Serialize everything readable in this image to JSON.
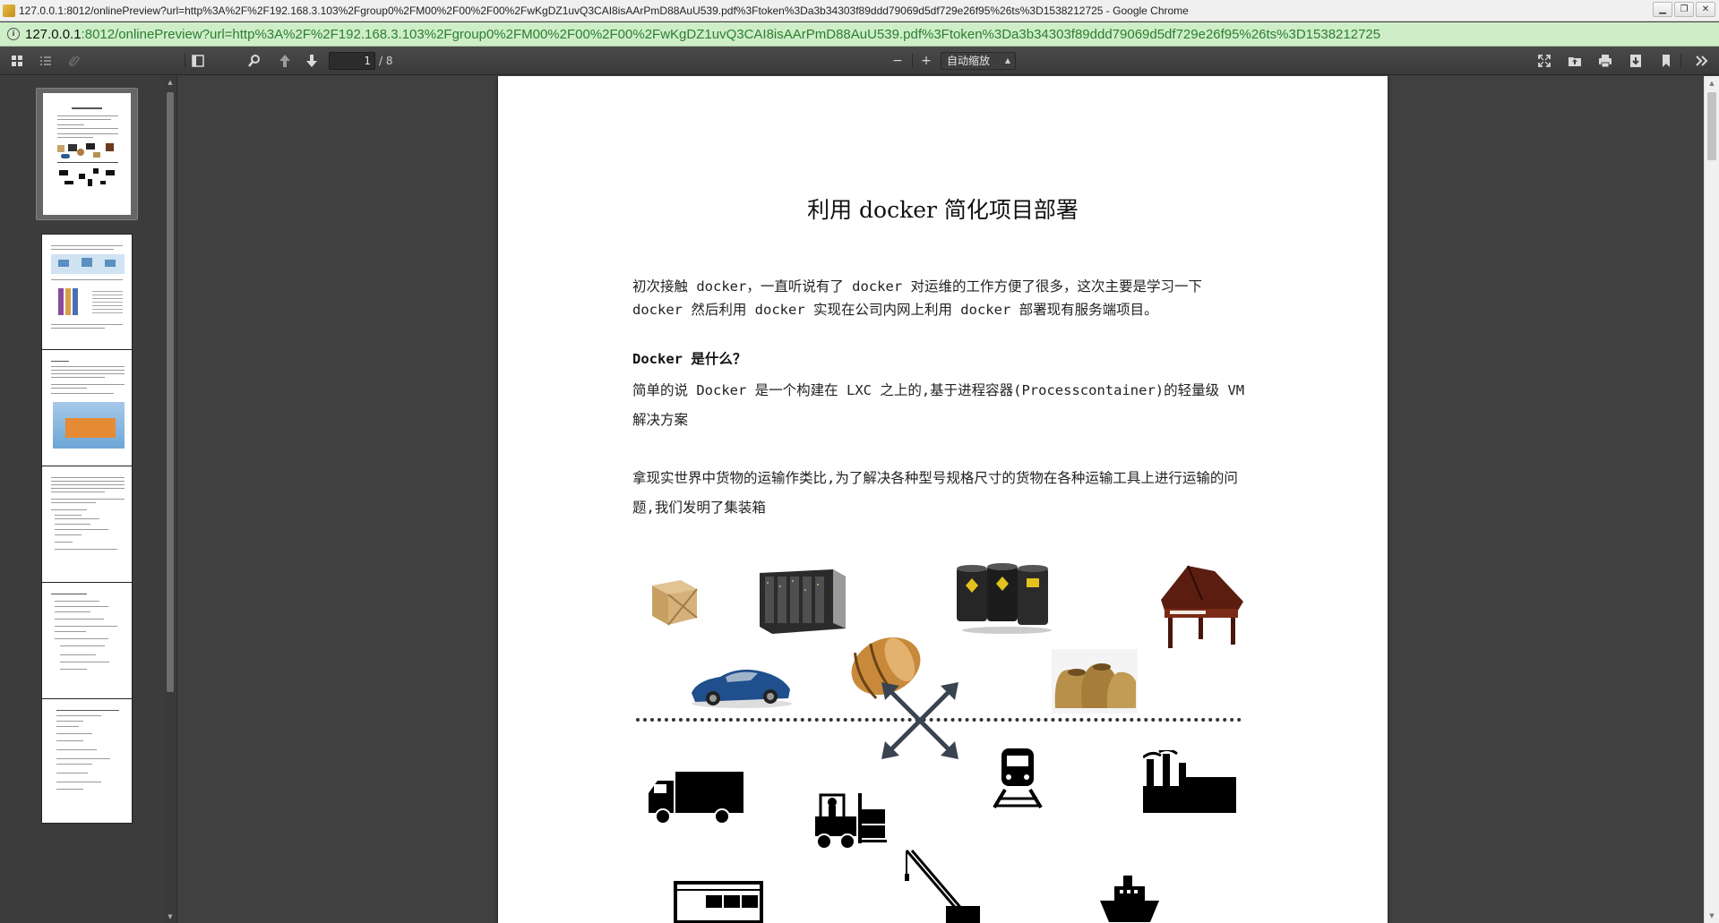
{
  "window": {
    "title": "127.0.0.1:8012/onlinePreview?url=http%3A%2F%2F192.168.3.103%2Fgroup0%2FM00%2F00%2F00%2FwKgDZ1uvQ3CAI8isAArPmD88AuU539.pdf%3Ftoken%3Da3b34303f89ddd79069d5df729e26f95%26ts%3D1538212725 - Google Chrome",
    "minimize": "▁",
    "restore": "❐",
    "close": "✕"
  },
  "address": {
    "host": "127.0.0.1",
    "path": ":8012/onlinePreview?url=http%3A%2F%2F192.168.3.103%2Fgroup0%2FM00%2F00%2F00%2FwKgDZ1uvQ3CAI8isAArPmD88AuU539.pdf%3Ftoken%3Da3b34303f89ddd79069d5df729e26f95%26ts%3D1538212725"
  },
  "toolbar": {
    "current_page": "1",
    "page_count": "/ 8",
    "zoom_label": "自动缩放",
    "zoom_out": "−",
    "zoom_in": "+"
  },
  "document": {
    "title": "利用 docker 简化项目部署",
    "para1": "初次接触 docker，一直听说有了 docker 对运维的工作方便了很多，这次主要是学习一下 docker 然后利用 docker 实现在公司内网上利用 docker 部署现有服务端项目。",
    "heading1": "Docker 是什么？",
    "para2": "简单的说 Docker 是一个构建在 LXC 之上的,基于进程容器(Processcontainer)的轻量级 VM 解决方案",
    "para3": "拿现实世界中货物的运输作类比,为了解决各种型号规格尺寸的货物在各种运输工具上进行运输的问题,我们发明了集装箱"
  },
  "icons": {
    "sidebar_toggle": "sidebar-toggle-icon",
    "search": "search-icon",
    "prev": "arrow-up-icon",
    "next": "arrow-down-icon"
  }
}
